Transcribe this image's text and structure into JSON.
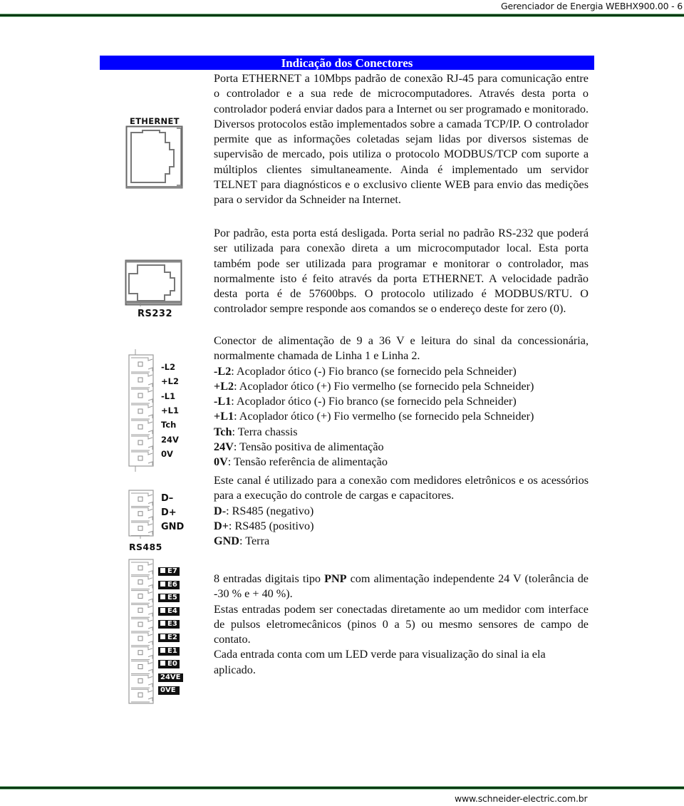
{
  "header": {
    "title": "Gerenciador de Energia WEBHX900.00 - 6"
  },
  "footer": {
    "url": "www.schneider-electric.com.br"
  },
  "section_title": "Indicação dos Conectores",
  "ethernet": {
    "figure_label": "ETHERNET",
    "paragraphs": [
      "Porta ETHERNET a 10Mbps padrão de conexão RJ-45 para comunicação entre o controlador e a sua rede de microcomputadores. Através desta porta o controlador poderá enviar dados para a Internet ou ser programado e monitorado. Diversos protocolos estão implementados sobre a camada TCP/IP. O controlador permite que as informações coletadas sejam lidas por diversos sistemas de supervisão de mercado, pois utiliza o protocolo MODBUS/TCP com suporte a múltiplos clientes simultaneamente. Ainda é implementado um servidor TELNET para diagnósticos e o exclusivo cliente WEB para envio das medições para o servidor da Schneider na Internet.",
      "Por padrão, esta porta está desligada."
    ]
  },
  "rs232": {
    "figure_label": "RS232",
    "paragraph": "Porta serial no padrão RS-232 que poderá ser utilizada para conexão direta a um microcomputador local. Esta porta também pode ser utilizada para programar e monitorar o controlador, mas normalmente isto é feito através da porta ETHERNET. A velocidade padrão desta porta é de 57600bps. O protocolo utilizado é MODBUS/RTU. O controlador sempre responde aos comandos se o endereço deste for zero (0)."
  },
  "power": {
    "figure_labels": [
      "-L2",
      "+L2",
      "-L1",
      "+L1",
      "Tch",
      "24V",
      "0V"
    ],
    "intro": "Conector de alimentação de 9 a 36 V e leitura do sinal da concessionária, normalmente chamada de Linha 1 e Linha 2.",
    "pins": [
      {
        "name": "-L2",
        "desc": ": Acoplador ótico (-) Fio branco (se fornecido pela Schneider)"
      },
      {
        "name": "+L2",
        "desc": ": Acoplador ótico (+) Fio vermelho (se fornecido pela Schneider)"
      },
      {
        "name": "-L1",
        "desc": ": Acoplador ótico (-) Fio branco (se fornecido pela Schneider)"
      },
      {
        "name": "+L1",
        "desc": ": Acoplador ótico (+) Fio vermelho (se fornecido pela Schneider)"
      },
      {
        "name": "Tch",
        "desc": ": Terra chassis"
      },
      {
        "name": "24V",
        "desc": ": Tensão positiva de alimentação"
      },
      {
        "name": "0V",
        "desc": ": Tensão referência de alimentação"
      }
    ]
  },
  "rs485": {
    "figure_title": "RS485",
    "figure_labels": [
      "D–",
      "D+",
      "GND"
    ],
    "intro": "Este canal é utilizado para a conexão com medidores eletrônicos e os acessórios para a execução do controle de cargas e capacitores.",
    "pins": [
      {
        "name": "D-",
        "desc": ": RS485 (negativo)"
      },
      {
        "name": "D+",
        "desc": ": RS485 (positivo)"
      },
      {
        "name": "GND",
        "desc": ": Terra"
      }
    ]
  },
  "digital_inputs": {
    "figure_labels": [
      "E7",
      "E6",
      "E5",
      "E4",
      "E3",
      "E2",
      "E1",
      "E0",
      "24VE",
      "0VE"
    ],
    "line1_pre": "8 entradas digitais tipo ",
    "line1_bold": "PNP",
    "line1_post": " com alimentação independente 24 V (tolerância de -30 % e + 40 %).",
    "para2": "Estas entradas podem ser conectadas diretamente ao um medidor com interface de pulsos eletromecânicos (pinos 0 a 5) ou mesmo sensores de campo de contato.",
    "para3": "Cada entrada conta com um LED verde para visualização do sinal ia ela aplicado."
  }
}
